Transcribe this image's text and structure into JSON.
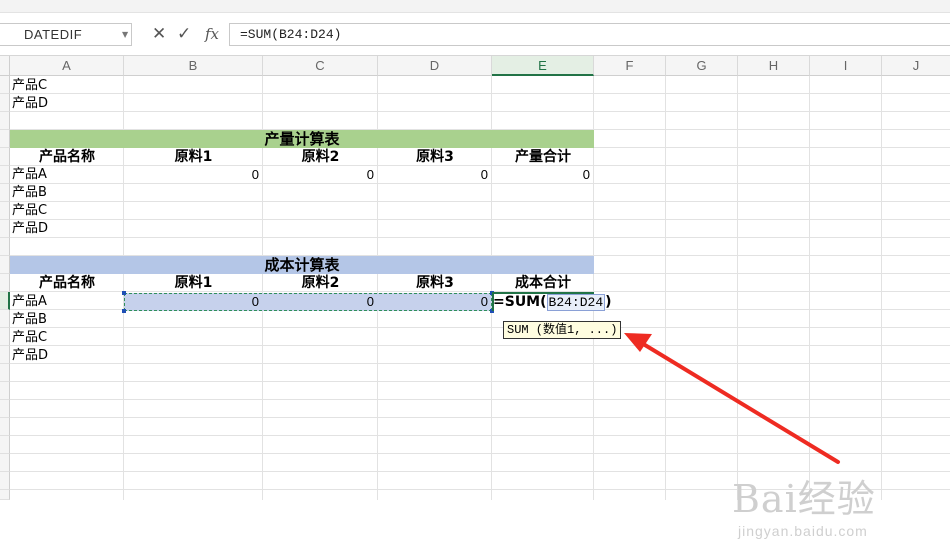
{
  "formula_bar": {
    "name_box": "DATEDIF",
    "cancel_icon": "close-icon",
    "confirm_icon": "check-icon",
    "fx_label": "fx",
    "formula": "=SUM(B24:D24)"
  },
  "columns": [
    "A",
    "B",
    "C",
    "D",
    "E",
    "F",
    "G",
    "H",
    "I",
    "J"
  ],
  "active_column": "E",
  "sheet": {
    "top_rows": [
      "产品C",
      "产品D"
    ],
    "production_table": {
      "title": "产量计算表",
      "headers": [
        "产品名称",
        "原料1",
        "原料2",
        "原料3",
        "产量合计"
      ],
      "rows": [
        {
          "name": "产品A",
          "values": [
            "0",
            "0",
            "0"
          ],
          "total": "0"
        },
        {
          "name": "产品B"
        },
        {
          "name": "产品C"
        },
        {
          "name": "产品D"
        }
      ]
    },
    "cost_table": {
      "title": "成本计算表",
      "headers": [
        "产品名称",
        "原料1",
        "原料2",
        "原料3",
        "成本合计"
      ],
      "rows": [
        {
          "name": "产品A",
          "values": [
            "0",
            "0",
            "0"
          ]
        },
        {
          "name": "产品B"
        },
        {
          "name": "产品C"
        },
        {
          "name": "产品D"
        }
      ]
    }
  },
  "editing": {
    "formula_prefix": "=SUM(",
    "formula_ref": "B24:D24",
    "formula_suffix": ")",
    "tooltip": "SUM (数值1, ...)"
  },
  "watermark": {
    "brand": "Bai经验",
    "url": "jingyan.baidu.com"
  },
  "colors": {
    "production_header": "#a9d18e",
    "cost_header": "#b4c6e7",
    "selection_fill": "#c6d1ec",
    "active_green": "#217346",
    "arrow": "#ee2b22"
  }
}
